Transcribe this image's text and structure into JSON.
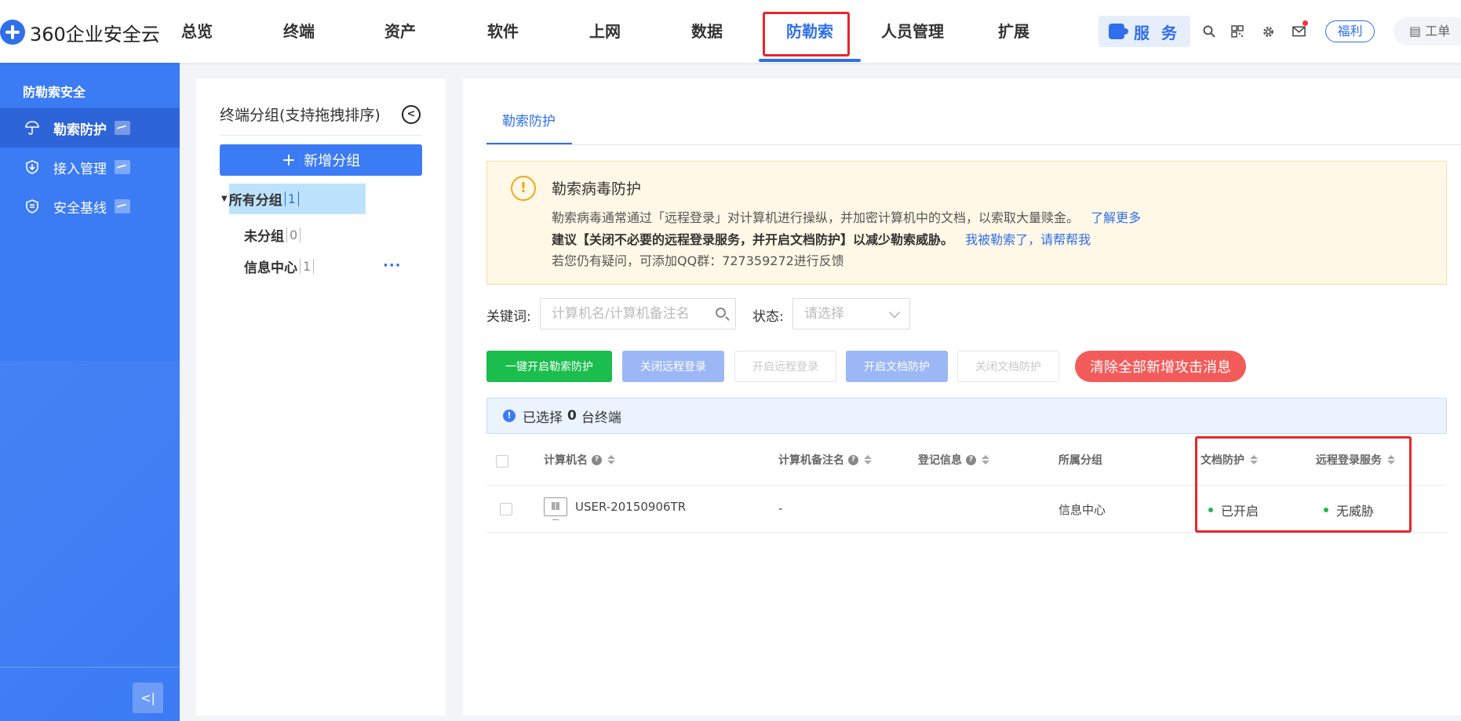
{
  "app": {
    "logo_text": "360企业安全云"
  },
  "nav": {
    "items": [
      "总览",
      "终端",
      "资产",
      "软件",
      "上网",
      "数据",
      "防勒索",
      "人员管理",
      "扩展"
    ],
    "active": "防勒索",
    "service_label": "服 务",
    "fuli_label": "福利",
    "order_label": "工单",
    "icons": [
      "search-icon",
      "qrcode-icon",
      "gear-icon",
      "mail-icon"
    ]
  },
  "sidebar": {
    "title": "防勒索安全",
    "items": [
      {
        "label": "勒索防护",
        "icon": "umbrella-icon",
        "active": true
      },
      {
        "label": "接入管理",
        "icon": "download-shield-icon",
        "active": false
      },
      {
        "label": "安全基线",
        "icon": "shield-list-icon",
        "active": false
      }
    ],
    "collapse_label": "<|"
  },
  "groups": {
    "title": "终端分组(支持拖拽排序)",
    "add_label": "新增分组",
    "tree": [
      {
        "label": "所有分组",
        "count": "1"
      },
      {
        "label": "未分组",
        "count": "0"
      },
      {
        "label": "信息中心",
        "count": "1"
      }
    ],
    "more": "···"
  },
  "main": {
    "tab": "勒索防护",
    "alert": {
      "title": "勒索病毒防护",
      "line1": "勒索病毒通常通过「远程登录」对计算机进行操纵，并加密计算机中的文档，以索取大量赎金。",
      "line1_link": "了解更多",
      "line2": "建议【关闭不必要的远程登录服务，并开启文档防护】以减少勒索威胁。",
      "line2_link": "我被勒索了，请帮帮我",
      "line3": "若您仍有疑问，可添加QQ群：727359272进行反馈"
    },
    "filters": {
      "keyword_label": "关键词:",
      "keyword_placeholder": "计算机名/计算机备注名",
      "status_label": "状态:",
      "status_placeholder": "请选择"
    },
    "buttons": {
      "enable_all": "一键开启勒索防护",
      "close_remote": "关闭远程登录",
      "open_remote": "开启远程登录",
      "enable_doc": "开启文档防护",
      "close_doc": "关闭文档防护",
      "clear_msgs": "清除全部新增攻击消息"
    },
    "selection": {
      "prefix": "已选择",
      "count": "0",
      "suffix": "台终端"
    },
    "table": {
      "headers": [
        "计算机名",
        "计算机备注名",
        "登记信息",
        "所属分组",
        "文档防护",
        "远程登录服务"
      ],
      "rows": [
        {
          "name": "USER-20150906TR",
          "remark": "-",
          "info": "",
          "group": "信息中心",
          "doc": "已开启",
          "remote": "无威胁"
        }
      ]
    }
  },
  "colors": {
    "accent": "#2f6fea",
    "sidebar": "#3b7bf4",
    "highlight": "#e8262a",
    "ok": "#1bbd4d"
  }
}
